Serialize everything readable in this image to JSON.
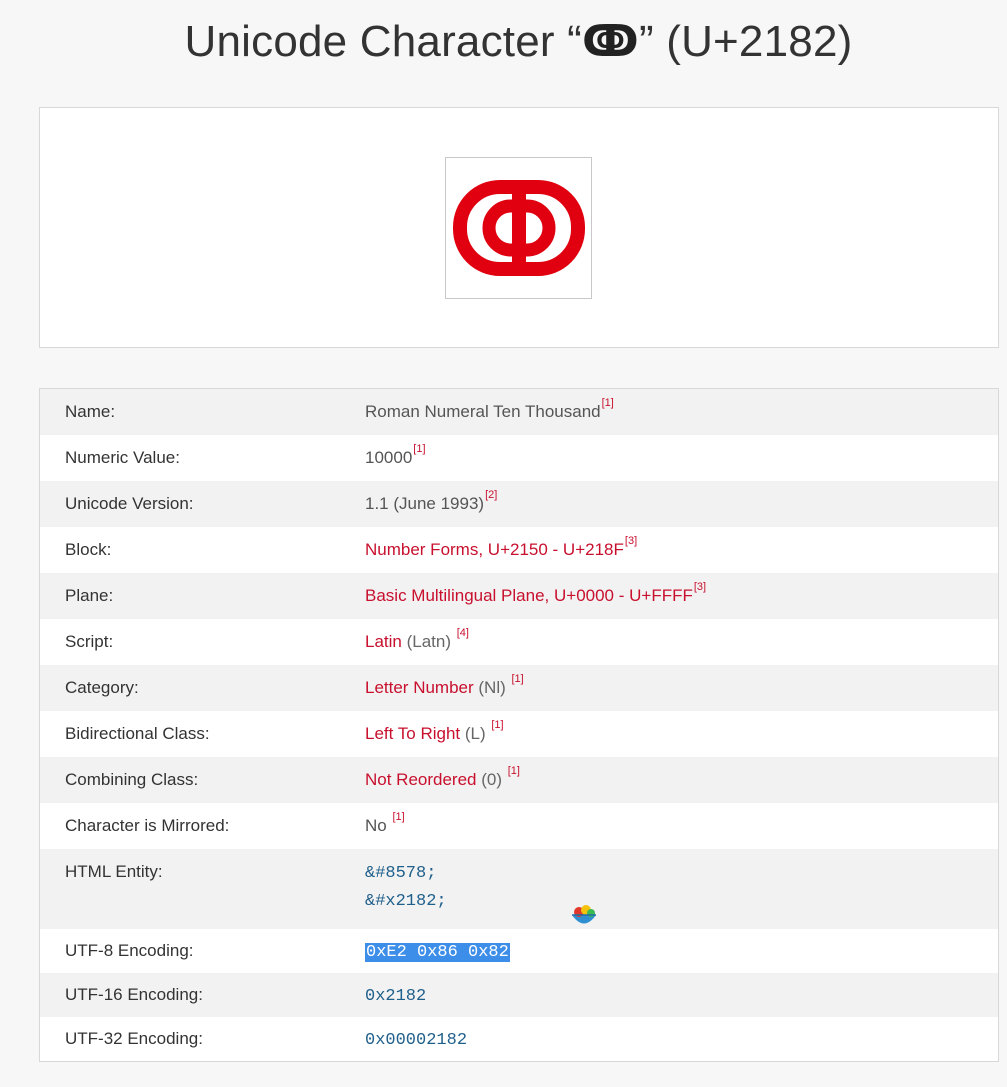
{
  "page": {
    "title_prefix": "Unicode Character “",
    "title_char": "ↂ",
    "title_suffix": "” (U+2182)"
  },
  "glyph": {
    "icon": "roman-numeral-ten-thousand-glyph",
    "color": "#e0000f"
  },
  "rows": [
    {
      "label": "Name:",
      "value": "Roman Numeral Ten Thousand",
      "ref": "[1]"
    },
    {
      "label": "Numeric Value:",
      "value": "10000",
      "ref": "[1]"
    },
    {
      "label": "Unicode Version:",
      "value": "1.1 (June 1993)",
      "ref": "[2]"
    },
    {
      "label": "Block:",
      "link": "Number Forms, U+2150 - U+218F",
      "ref": "[3]"
    },
    {
      "label": "Plane:",
      "link": "Basic Multilingual Plane, U+0000 - U+FFFF",
      "ref": "[3]"
    },
    {
      "label": "Script:",
      "link": "Latin",
      "extra": " (Latn) ",
      "ref": "[4]"
    },
    {
      "label": "Category:",
      "link": "Letter Number",
      "extra": " (Nl) ",
      "ref": "[1]"
    },
    {
      "label": "Bidirectional Class:",
      "link": "Left To Right",
      "extra": " (L) ",
      "ref": "[1]"
    },
    {
      "label": "Combining Class:",
      "link": "Not Reordered",
      "extra": " (0) ",
      "ref": "[1]"
    },
    {
      "label": "Character is Mirrored:",
      "value": "No ",
      "ref": "[1]"
    }
  ],
  "html_entity": {
    "label": "HTML Entity:",
    "values": [
      "&#8578;",
      "&#x2182;"
    ]
  },
  "encodings": [
    {
      "label": "UTF-8 Encoding:",
      "value": "0xE2 0x86 0x82",
      "selected": true
    },
    {
      "label": "UTF-16 Encoding:",
      "value": "0x2182"
    },
    {
      "label": "UTF-32 Encoding:",
      "value": "0x00002182"
    }
  ],
  "colors": {
    "link": "#c8102e",
    "mono": "#1f5f8b",
    "selection": "#3d8ee8"
  }
}
